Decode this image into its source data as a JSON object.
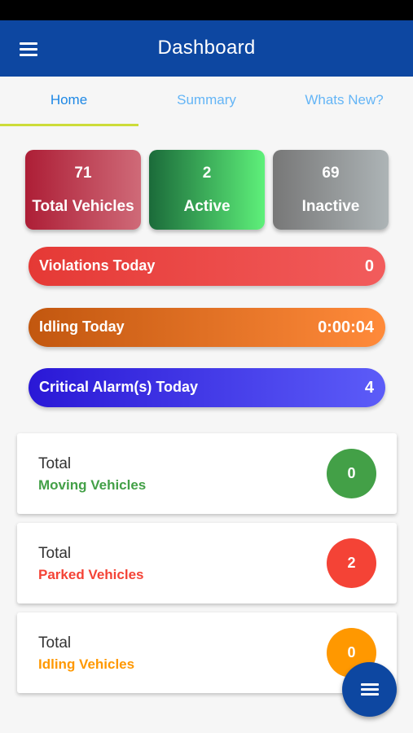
{
  "app_bar": {
    "title": "Dashboard",
    "menu_icon": "hamburger-menu-icon",
    "color": "#0d47a1"
  },
  "tabs": [
    {
      "label": "Home",
      "active": true
    },
    {
      "label": "Summary",
      "active": false
    },
    {
      "label": "Whats New?",
      "active": false
    }
  ],
  "stats": {
    "total": {
      "value": "71",
      "label": "Total Vehicles"
    },
    "active": {
      "value": "2",
      "label": "Active"
    },
    "inactive": {
      "value": "69",
      "label": "Inactive"
    }
  },
  "today": {
    "violations": {
      "label": "Violations Today",
      "value": "0"
    },
    "idling": {
      "label": "Idling Today",
      "value": "0:00:04"
    },
    "critical": {
      "label": "Critical Alarm(s) Today",
      "value": "4"
    }
  },
  "vehicle_counts": {
    "moving": {
      "title": "Total",
      "label": "Moving Vehicles",
      "count": "0",
      "color": "#43a047"
    },
    "parked": {
      "title": "Total",
      "label": "Parked Vehicles",
      "count": "2",
      "color": "#f44336"
    },
    "idling": {
      "title": "Total",
      "label": "Idling Vehicles",
      "count": "0",
      "color": "#ff9800"
    }
  },
  "fab": {
    "icon": "menu-icon"
  }
}
